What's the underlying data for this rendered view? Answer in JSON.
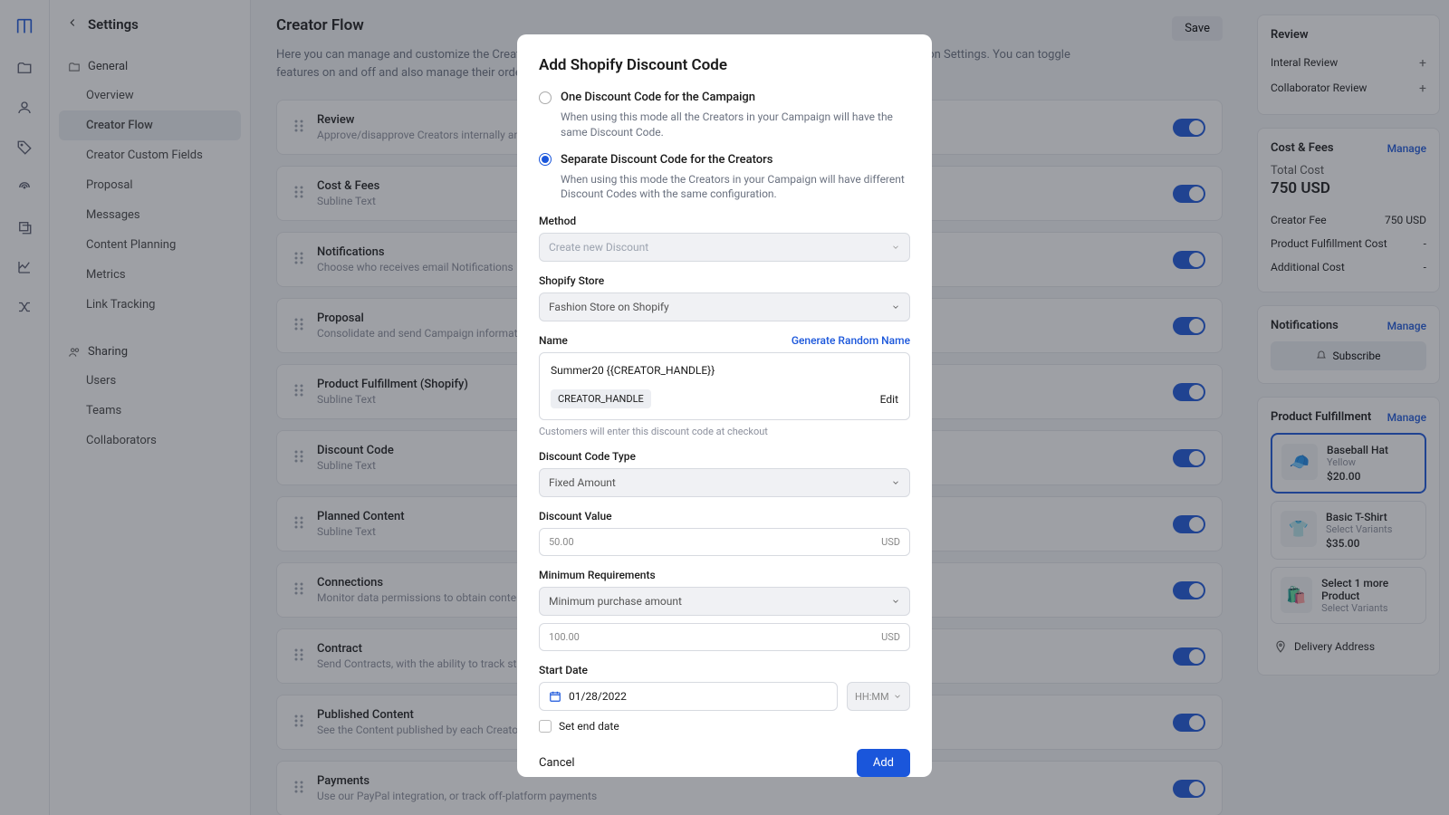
{
  "sidebar": {
    "title": "Settings",
    "group_general": "General",
    "items": [
      "Overview",
      "Creator Flow",
      "Creator Custom Fields",
      "Proposal",
      "Messages",
      "Content Planning",
      "Metrics",
      "Link Tracking"
    ],
    "group_sharing": "Sharing",
    "sharing_items": [
      "Users",
      "Teams",
      "Collaborators"
    ]
  },
  "main": {
    "title": "Creator Flow",
    "save": "Save",
    "desc": "Here you can manage and customize the Creator Flow. Changes done here affect all Users and are separated from Organization Settings. You can toggle features on and off and also manage their order.",
    "rows": [
      {
        "title": "Review",
        "sub": "Approve/disapprove Creators internally and together with your Client"
      },
      {
        "title": "Cost & Fees",
        "sub": "Subline Text"
      },
      {
        "title": "Notifications",
        "sub": "Choose who receives email Notifications"
      },
      {
        "title": "Proposal",
        "sub": " Consolidate and send Campaign information to creators via email"
      },
      {
        "title": "Product Fulfillment (Shopify)",
        "sub": "Subline Text"
      },
      {
        "title": "Discount Code",
        "sub": "Subline Text"
      },
      {
        "title": "Planned Content",
        "sub": "Subline Text"
      },
      {
        "title": "Connections",
        "sub": "Monitor data permissions to obtain content and performance"
      },
      {
        "title": "Contract",
        "sub": "Send Contracts, with the ability to track status and request signatures"
      },
      {
        "title": "Published Content",
        "sub": "See the Content published by each Creator"
      },
      {
        "title": "Payments",
        "sub": "Use our PayPal integration, or track off-platform payments"
      }
    ]
  },
  "right": {
    "review": {
      "title": "Review",
      "r1": "Interal Review",
      "r2": "Collaborator Review"
    },
    "cost": {
      "title": "Cost & Fees",
      "manage": "Manage",
      "tc_label": "Total Cost",
      "tc_value": "750 USD",
      "cf": "Creator Fee",
      "cf_v": "750 USD",
      "pfc": "Product Fulfillment Cost",
      "ac": "Additional Cost",
      "dash": "-"
    },
    "notif": {
      "title": "Notifications",
      "manage": "Manage",
      "btn": "Subscribe"
    },
    "pf": {
      "title": "Product Fulfillment",
      "manage": "Manage",
      "p1": {
        "name": "Baseball Hat",
        "sub": "Yellow",
        "price": "$20.00"
      },
      "p2": {
        "name": "Basic T-Shirt",
        "sub": "Select Variants",
        "price": "$35.00"
      },
      "p3": {
        "name": "Select 1 more Product",
        "sub": "Select Variants"
      },
      "deliv": "Delivery Address"
    }
  },
  "modal": {
    "title": "Add Shopify Discount Code",
    "opt1": {
      "title": "One Discount Code for the Campaign",
      "desc": "When using this mode all the Creators in your Campaign will have the same Discount Code."
    },
    "opt2": {
      "title": "Separate Discount Code for the Creators",
      "desc": "When using this mode the Creators in your Campaign will have different Discount Codes with the same configuration."
    },
    "method": {
      "label": "Method",
      "value": "Create new Discount"
    },
    "store": {
      "label": "Shopify Store",
      "value": "Fashion Store on Shopify"
    },
    "name": {
      "label": "Name",
      "link": "Generate Random Name",
      "value": "Summer20 {{CREATOR_HANDLE}}",
      "tag": "CREATOR_HANDLE",
      "edit": "Edit",
      "hint": "Customers will enter this discount code at checkout"
    },
    "type": {
      "label": "Discount Code Type",
      "value": "Fixed Amount"
    },
    "dval": {
      "label": "Discount Value",
      "value": "50.00",
      "unit": "USD"
    },
    "minreq": {
      "label": "Minimum Requirements",
      "value": "Minimum purchase amount",
      "amount": "100.00",
      "unit": "USD"
    },
    "start": {
      "label": "Start Date",
      "value": "01/28/2022",
      "time": "HH:MM",
      "end": "Set end date"
    },
    "cancel": "Cancel",
    "add": "Add"
  }
}
